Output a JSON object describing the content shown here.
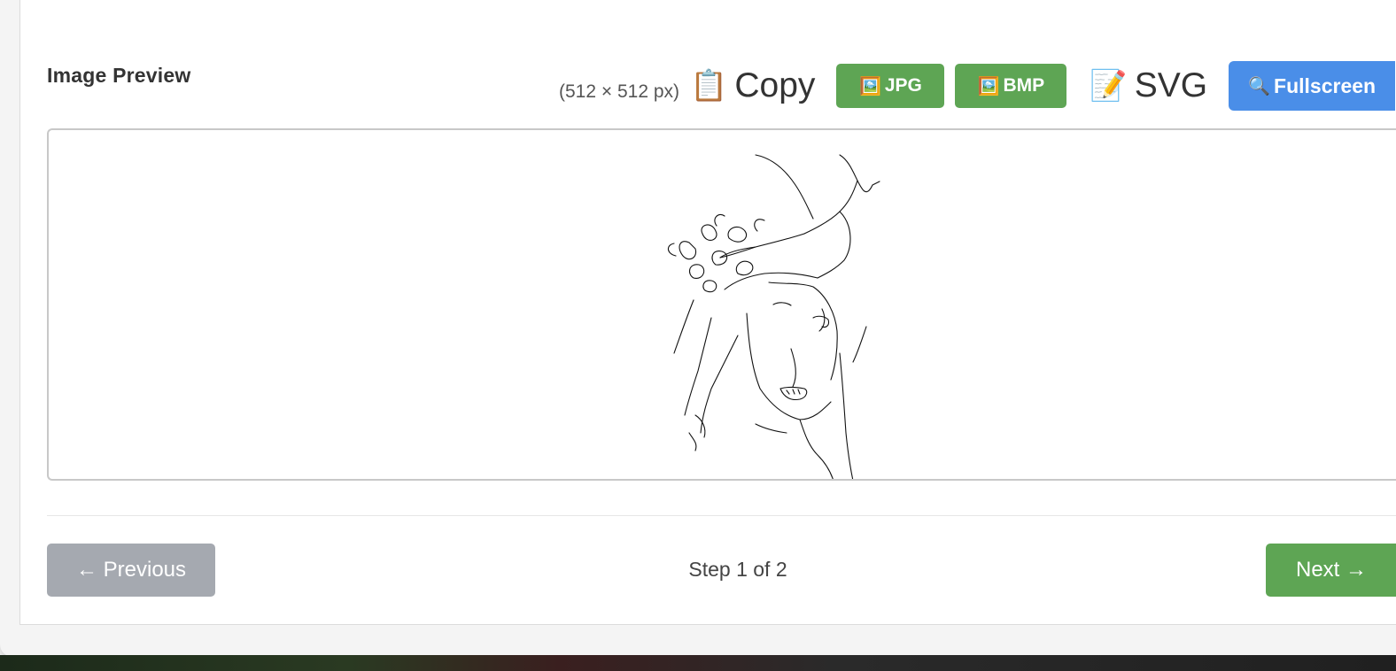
{
  "preview": {
    "title": "Image Preview",
    "dimensions": "(512 × 512 px)",
    "image_alt": "Edge-detected line drawing of a woman wearing a hat"
  },
  "toolbar": {
    "copy": {
      "icon": "📋",
      "label": "Copy"
    },
    "jpg": {
      "icon": "🖼️",
      "label": "JPG"
    },
    "bmp": {
      "icon": "🖼️",
      "label": "BMP"
    },
    "svg": {
      "icon": "📝",
      "label": "SVG"
    },
    "fullscreen": {
      "icon": "🔍",
      "label": "Fullscreen"
    }
  },
  "navigation": {
    "previous_label": "← Previous",
    "step_text": "Step 1 of 2",
    "next_label": "Next →"
  },
  "colors": {
    "green_button": "#5ea554",
    "blue_button": "#4a8ee8",
    "disabled_button": "#a5a9b0"
  }
}
